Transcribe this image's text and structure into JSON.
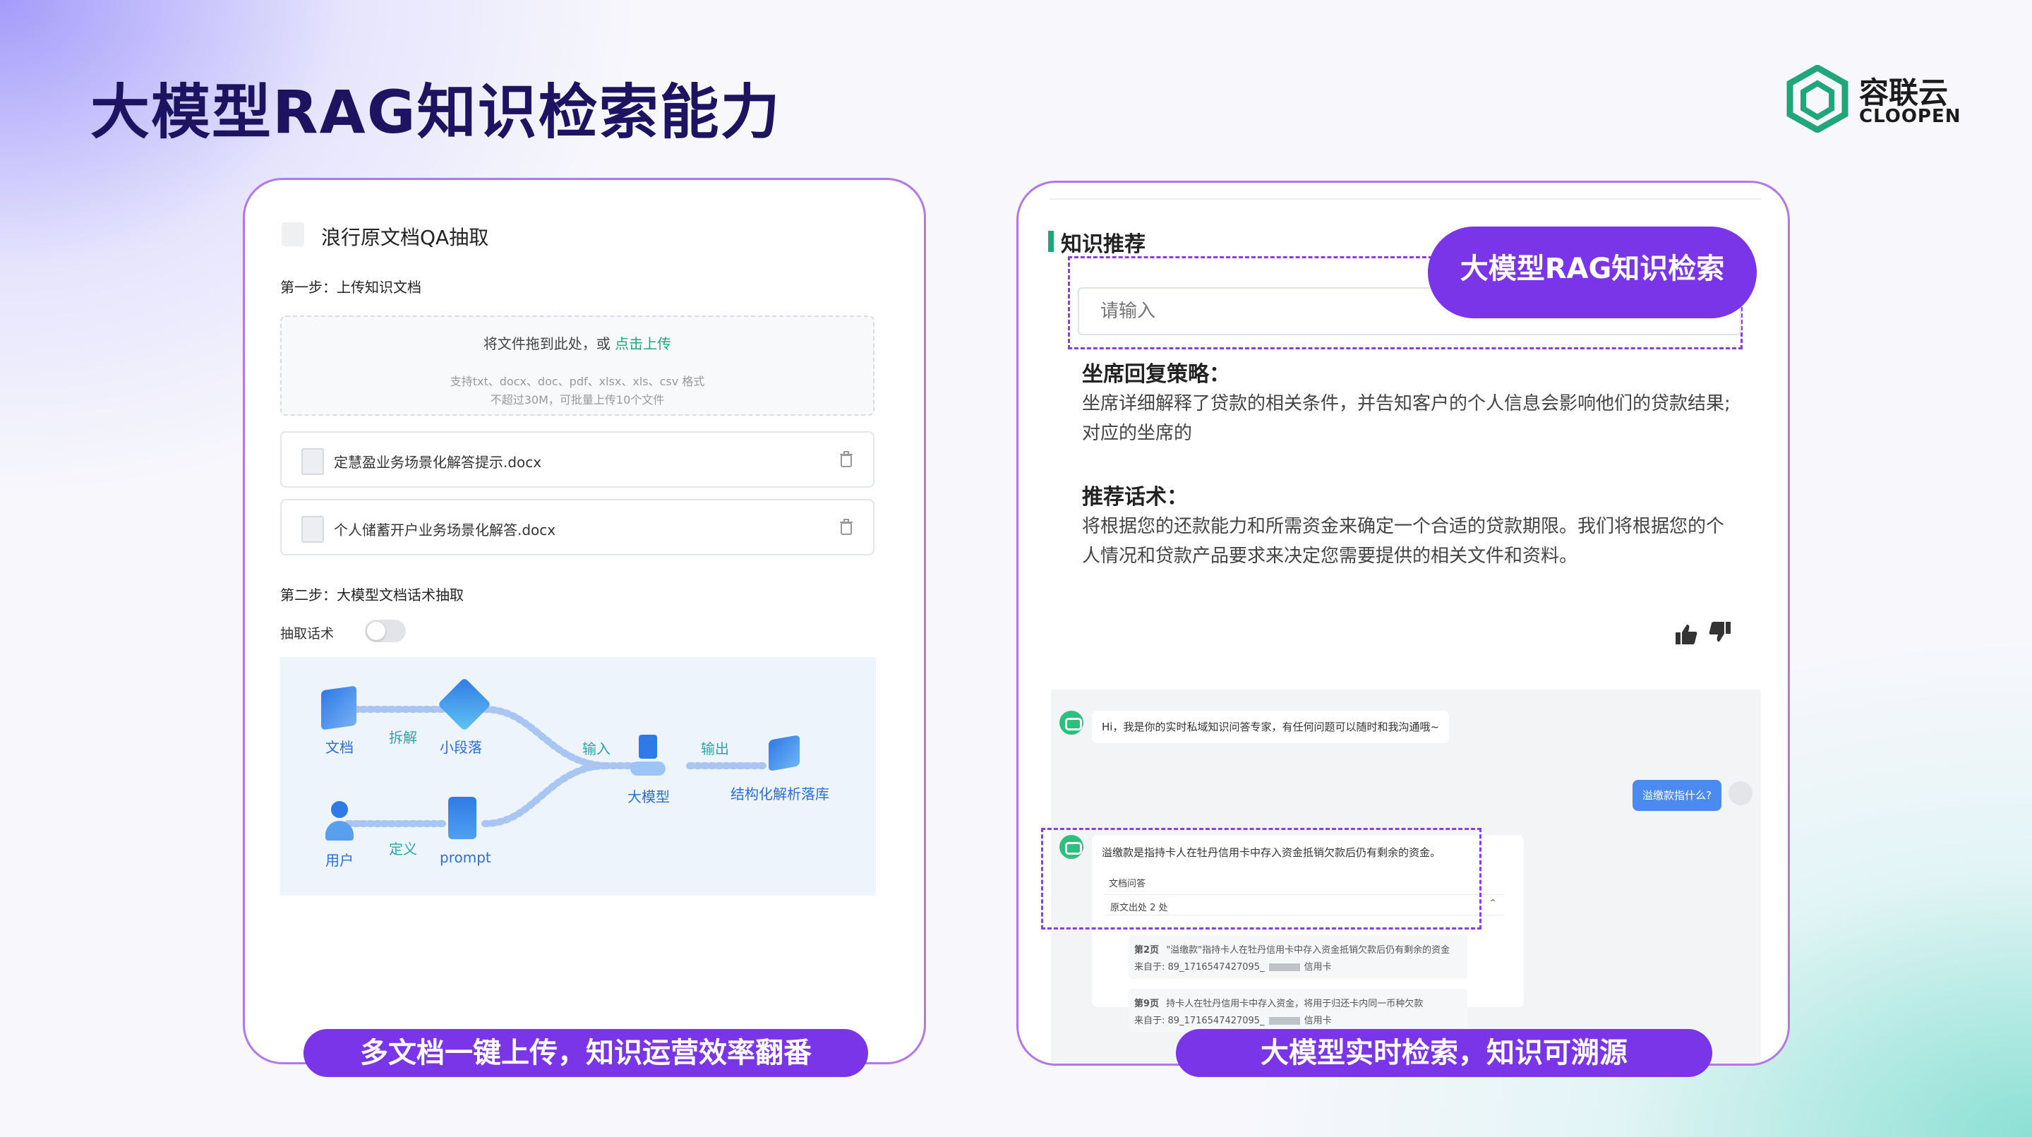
{
  "slide": {
    "title": "大模型RAG知识检索能力",
    "logo": {
      "cn": "容联云",
      "en": "CLOOPEN",
      "brand_color": "#1fa77a"
    },
    "accent": "#7a35e8"
  },
  "left_card": {
    "header": "浪行原文档QA抽取",
    "step1": "第一步：上传知识文档",
    "upload": {
      "prompt": "将文件拖到此处，或",
      "link": "点击上传",
      "formats": "支持txt、docx、doc、pdf、xlsx、xls、csv 格式",
      "limit": "不超过30M，可批量上传10个文件"
    },
    "files": [
      {
        "name": "定慧盈业务场景化解答提示.docx"
      },
      {
        "name": "个人储蓄开户业务场景化解答.docx"
      }
    ],
    "step2": "第二步：大模型文档话术抽取",
    "extract_label": "抽取话术",
    "extract_on": false,
    "flow": {
      "doc": "文档",
      "split": "拆解",
      "chunk": "小段落",
      "user": "用户",
      "define": "定义",
      "prompt": "prompt",
      "input": "输入",
      "llm": "大模型",
      "output": "输出",
      "store": "结构化解析落库"
    },
    "footer_pill": "多文档一键上传，知识运营效率翻番"
  },
  "right_card": {
    "section_title": "知识推荐",
    "search_placeholder": "请输入",
    "badge": "大模型RAG知识检索",
    "strategy_title": "坐席回复策略：",
    "strategy_text": "坐席详细解释了贷款的相关条件，并告知客户的个人信息会影响他们的贷款结果; 对应的坐席的",
    "script_title": "推荐话术：",
    "script_text": "将根据您的还款能力和所需资金来确定一个合适的贷款期限。我们将根据您的个人情况和贷款产品要求来决定您需要提供的相关文件和资料。",
    "chat": {
      "greeting": "Hi，我是你的实时私域知识问答专家，有任何问题可以随时和我沟通哦~",
      "user_question": "溢缴款指什么?",
      "answer": "溢缴款是指持卡人在牡丹信用卡中存入资金抵销欠款后仍有剩余的资金。",
      "doc_qa_label": "文档问答",
      "sources_label": "原文出处 2 处",
      "sources": [
        {
          "page": "第2页",
          "text": "\"溢缴款\"指持卡人在牡丹信用卡中存入资金抵销欠款后仍有剩余的资金",
          "from": "来自于: 89_1716547427095_",
          "suffix": "信用卡"
        },
        {
          "page": "第9页",
          "text": "持卡人在牡丹信用卡中存入资金，将用于归还卡内同一币种欠款",
          "from": "来自于: 89_1716547427095_",
          "suffix": "信用卡"
        }
      ]
    },
    "footer_pill": "大模型实时检索，知识可溯源"
  }
}
